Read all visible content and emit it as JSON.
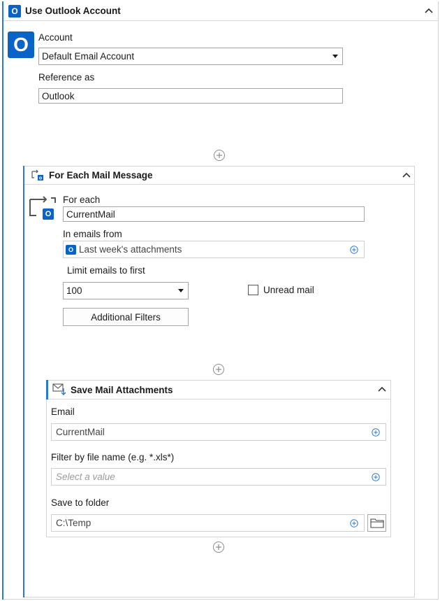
{
  "outer": {
    "title": "Use Outlook Account",
    "badge": "O",
    "account_label": "Account",
    "account_value": "Default Email Account",
    "reference_label": "Reference as",
    "reference_value": "Outlook"
  },
  "foreach": {
    "title": "For Each Mail Message",
    "badge": "O",
    "for_each_label": "For each",
    "for_each_value": "CurrentMail",
    "emails_from_label": "In emails from",
    "emails_from_badge": "O",
    "emails_from_value": "Last week's attachments",
    "limit_label": "Limit emails to first",
    "limit_value": "100",
    "unread_label": "Unread mail",
    "unread_checked": false,
    "filters_button": "Additional Filters"
  },
  "save": {
    "title": "Save Mail Attachments",
    "email_label": "Email",
    "email_value": "CurrentMail",
    "filter_label": "Filter by file name (e.g. *.xls*)",
    "filter_placeholder": "Select a value",
    "folder_label": "Save to folder",
    "folder_value": "C:\\Temp"
  },
  "colors": {
    "accent": "#2b79d6",
    "outlook_blue": "#0a64c8"
  },
  "icons": [
    "outlook-icon",
    "chevron-up-icon",
    "add-activity-icon",
    "loop-icon",
    "mail-download-icon",
    "plus-circle-icon",
    "folder-icon",
    "dropdown-arrow-icon"
  ]
}
